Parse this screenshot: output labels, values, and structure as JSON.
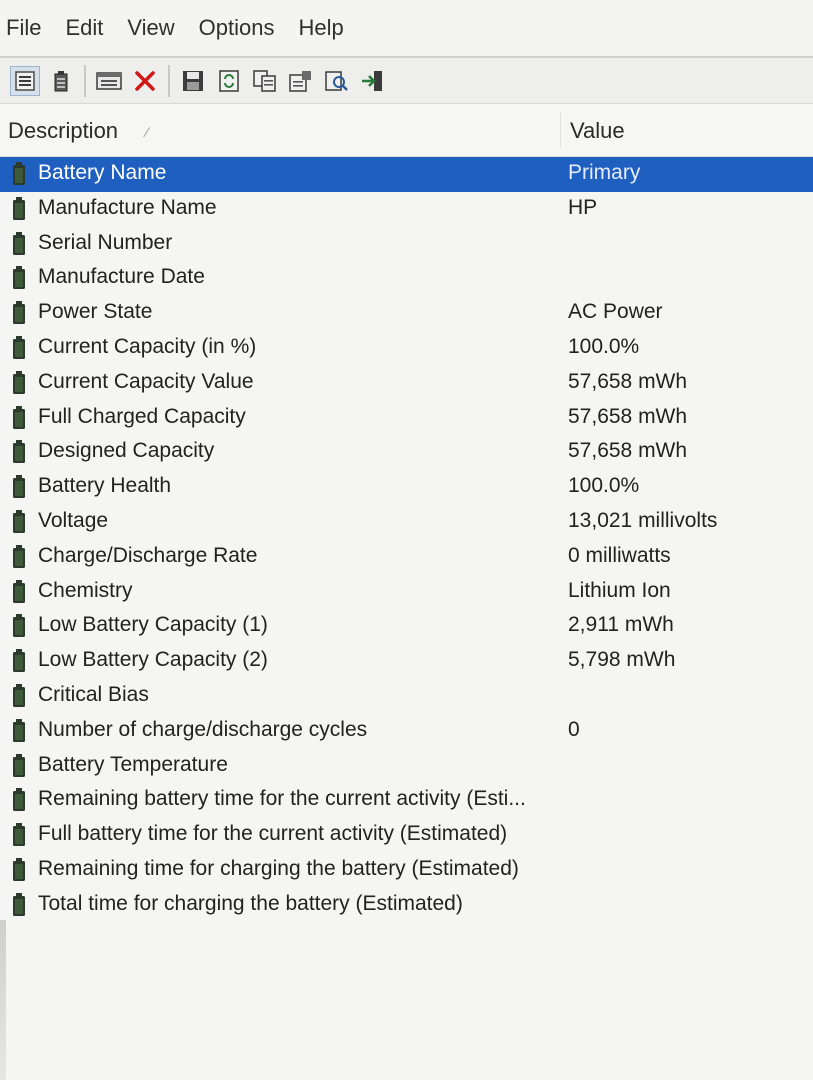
{
  "menu": [
    "File",
    "Edit",
    "View",
    "Options",
    "Help"
  ],
  "toolbar": {
    "icons": [
      "detail-view-icon",
      "battery-view-icon",
      "properties-window-icon",
      "delete-icon",
      "save-icon",
      "refresh-icon",
      "copy-icon",
      "properties-icon",
      "find-icon",
      "exit-icon"
    ]
  },
  "columns": {
    "description": "Description",
    "value": "Value"
  },
  "rows": [
    {
      "label": "Battery Name",
      "value": "Primary"
    },
    {
      "label": "Manufacture Name",
      "value": "HP"
    },
    {
      "label": "Serial Number",
      "value": ""
    },
    {
      "label": "Manufacture Date",
      "value": ""
    },
    {
      "label": "Power State",
      "value": "AC Power"
    },
    {
      "label": "Current Capacity (in %)",
      "value": "100.0%"
    },
    {
      "label": "Current Capacity Value",
      "value": "57,658 mWh"
    },
    {
      "label": "Full Charged Capacity",
      "value": "57,658 mWh"
    },
    {
      "label": "Designed Capacity",
      "value": "57,658 mWh"
    },
    {
      "label": "Battery Health",
      "value": "100.0%"
    },
    {
      "label": "Voltage",
      "value": "13,021 millivolts"
    },
    {
      "label": "Charge/Discharge Rate",
      "value": "0 milliwatts"
    },
    {
      "label": "Chemistry",
      "value": "Lithium Ion"
    },
    {
      "label": "Low Battery Capacity (1)",
      "value": "2,911 mWh"
    },
    {
      "label": "Low Battery Capacity (2)",
      "value": "5,798 mWh"
    },
    {
      "label": "Critical Bias",
      "value": ""
    },
    {
      "label": "Number of charge/discharge cycles",
      "value": "0"
    },
    {
      "label": "Battery Temperature",
      "value": ""
    },
    {
      "label": "Remaining battery time for the current activity (Esti...",
      "value": ""
    },
    {
      "label": "Full battery time for the current activity (Estimated)",
      "value": ""
    },
    {
      "label": "Remaining time for charging the battery (Estimated)",
      "value": ""
    },
    {
      "label": "Total  time for charging the battery (Estimated)",
      "value": ""
    }
  ],
  "selected_row": 0,
  "colors": {
    "selection": "#1f5fbf",
    "battery_icon": "#2b3a2a"
  }
}
